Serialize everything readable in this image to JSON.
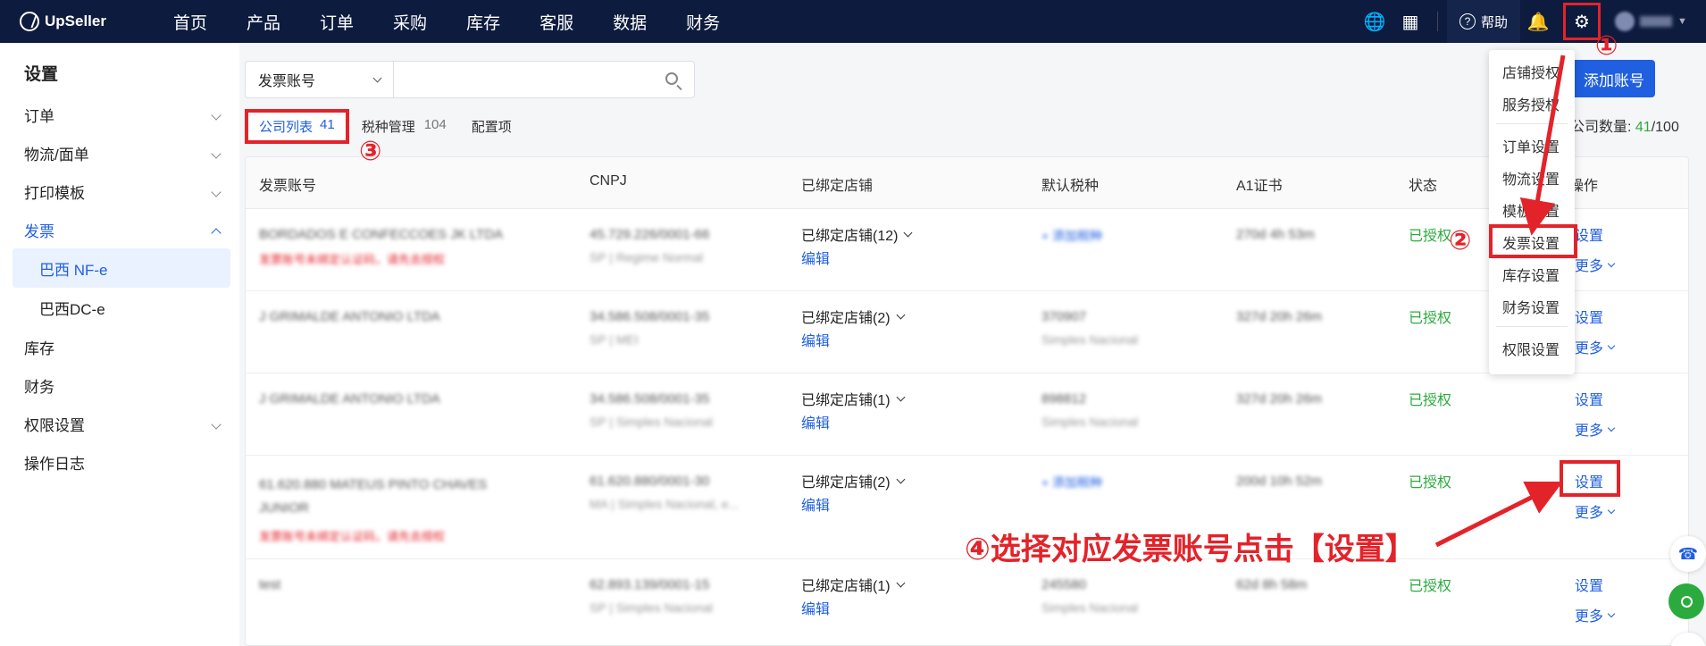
{
  "brand": "UpSeller",
  "nav": [
    "首页",
    "产品",
    "订单",
    "采购",
    "库存",
    "客服",
    "数据",
    "财务"
  ],
  "top_right": {
    "help": "帮助"
  },
  "sidebar": {
    "title": "设置",
    "items": [
      {
        "label": "订单"
      },
      {
        "label": "物流/面单"
      },
      {
        "label": "打印模板"
      },
      {
        "label": "发票"
      },
      {
        "label": "巴西 NF-e"
      },
      {
        "label": "巴西DC-e"
      },
      {
        "label": "库存"
      },
      {
        "label": "财务"
      },
      {
        "label": "权限设置"
      },
      {
        "label": "操作日志"
      }
    ]
  },
  "search": {
    "select_value": "发票账号",
    "placeholder": ""
  },
  "tabs": [
    {
      "label": "公司列表",
      "count": "41"
    },
    {
      "label": "税种管理",
      "count": "104"
    },
    {
      "label": "配置项",
      "count": ""
    }
  ],
  "add_button": "添加账号",
  "company_count": {
    "label": "公司数量:",
    "used": "41",
    "total": "/100"
  },
  "table": {
    "headers": [
      "发票账号",
      "CNPJ",
      "已绑定店铺",
      "默认税种",
      "A1证书",
      "状态",
      "操作"
    ],
    "rows": [
      {
        "account": "BORDADOS E CONFECCOES JK LTDA",
        "account_warn": "发票账号未绑定认证码，请先去授权",
        "cnpj": "45.729.226/0001-66",
        "regime": "SP | Regime Normal",
        "stores": "已绑定店铺(12)",
        "edit": "编辑",
        "tax": "+ 添加税种",
        "tax_sub": "",
        "cert": "270d 4h 53m",
        "status": "已授权",
        "set": "设置",
        "more": "更多"
      },
      {
        "account": "J GRIMALDE ANTONIO LTDA",
        "account_warn": "",
        "cnpj": "34.586.508/0001-35",
        "regime": "SP | MEI",
        "stores": "已绑定店铺(2)",
        "edit": "编辑",
        "tax": "370907",
        "tax_sub": "Simples Nacional",
        "cert": "327d 20h 26m",
        "status": "已授权",
        "set": "设置",
        "more": "更多"
      },
      {
        "account": "J GRIMALDE ANTONIO LTDA",
        "account_warn": "",
        "cnpj": "34.586.508/0001-35",
        "regime": "SP | Simples Nacional",
        "stores": "已绑定店铺(1)",
        "edit": "编辑",
        "tax": "898812",
        "tax_sub": "Simples Nacional",
        "cert": "327d 20h 26m",
        "status": "已授权",
        "set": "设置",
        "more": "更多"
      },
      {
        "account": "61.620.880 MATEUS PINTO CHAVES JUNIOR",
        "account_warn": "发票账号未绑定认证码，请先去授权",
        "cnpj": "61.620.880/0001-30",
        "regime": "MA | Simples Nacional, e...",
        "stores": "已绑定店铺(2)",
        "edit": "编辑",
        "tax": "+ 添加税种",
        "tax_sub": "",
        "cert": "200d 10h 52m",
        "status": "已授权",
        "set": "设置",
        "more": "更多"
      },
      {
        "account": "test",
        "account_warn": "",
        "cnpj": "62.893.139/0001-15",
        "regime": "SP | Simples Nacional",
        "stores": "已绑定店铺(1)",
        "edit": "编辑",
        "tax": "245580",
        "tax_sub": "Simples Nacional",
        "cert": "62d 8h 58m",
        "status": "已授权",
        "set": "设置",
        "more": "更多"
      }
    ]
  },
  "dropdown": [
    "店铺授权",
    "服务授权",
    "订单设置",
    "物流设置",
    "模板设置",
    "发票设置",
    "库存设置",
    "财务设置",
    "权限设置"
  ],
  "annotations": {
    "step1": "①",
    "step2": "②",
    "step3": "③",
    "step4_text": "④选择对应发票账号点击【设置】"
  },
  "colors": {
    "nav_bg": "#0d1b3e",
    "primary": "#1f5fe0",
    "success": "#2bab3e",
    "annotation": "#e3232a"
  }
}
